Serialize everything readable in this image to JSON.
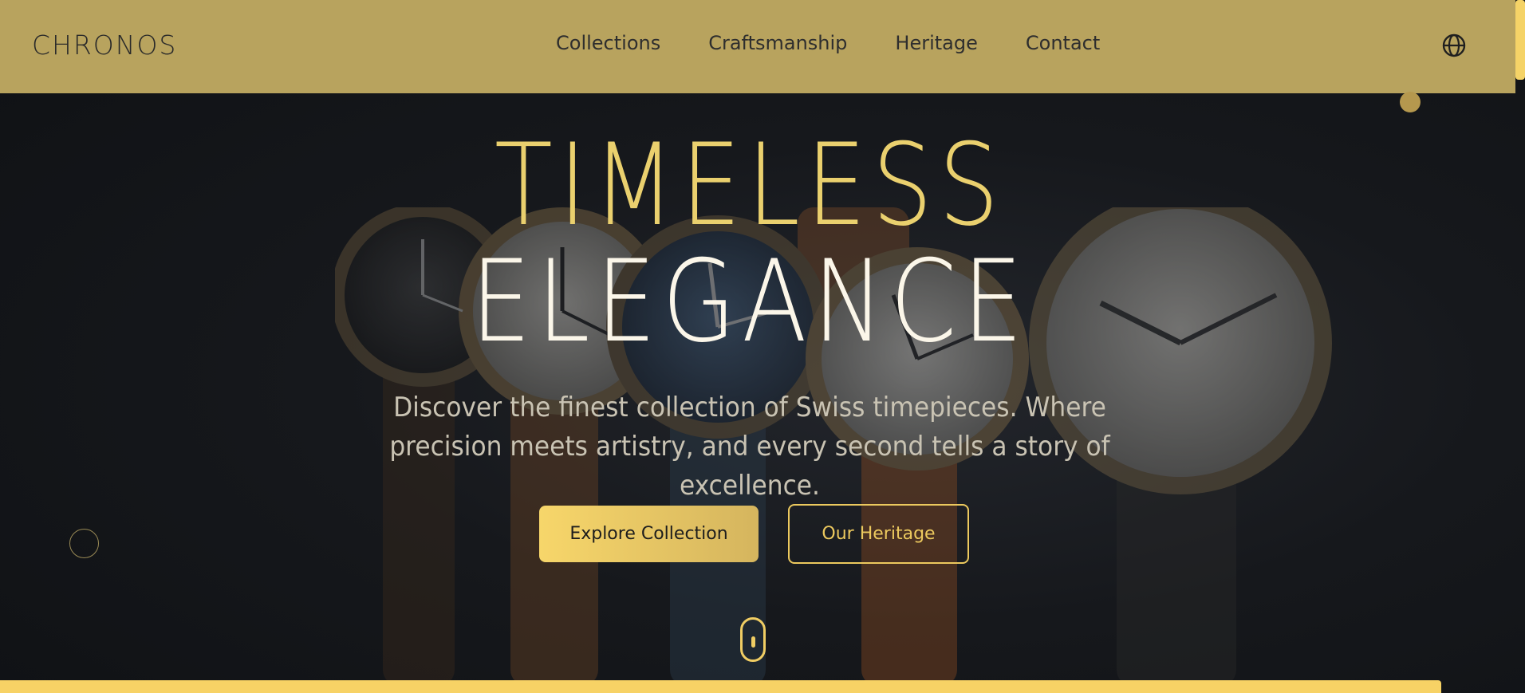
{
  "header": {
    "logo": "CHRONOS",
    "nav": [
      "Collections",
      "Craftsmanship",
      "Heritage",
      "Contact"
    ],
    "globe_icon": "globe-icon"
  },
  "hero": {
    "title_line1": "TIMELESS",
    "title_line2": "ELEGANCE",
    "subtitle": "Discover the finest collection of Swiss timepieces. Where precision meets artistry, and every second tells a story of excellence.",
    "primary_button": "Explore Collection",
    "secondary_button": "Our Heritage",
    "scroll_icon": "mouse-scroll-icon",
    "background_image": "luxury-watches-image"
  },
  "colors": {
    "header_bg": "#b8a35e",
    "gold": "#ead06e",
    "cream": "#fbf6e9",
    "dark_bg": "#111317"
  }
}
